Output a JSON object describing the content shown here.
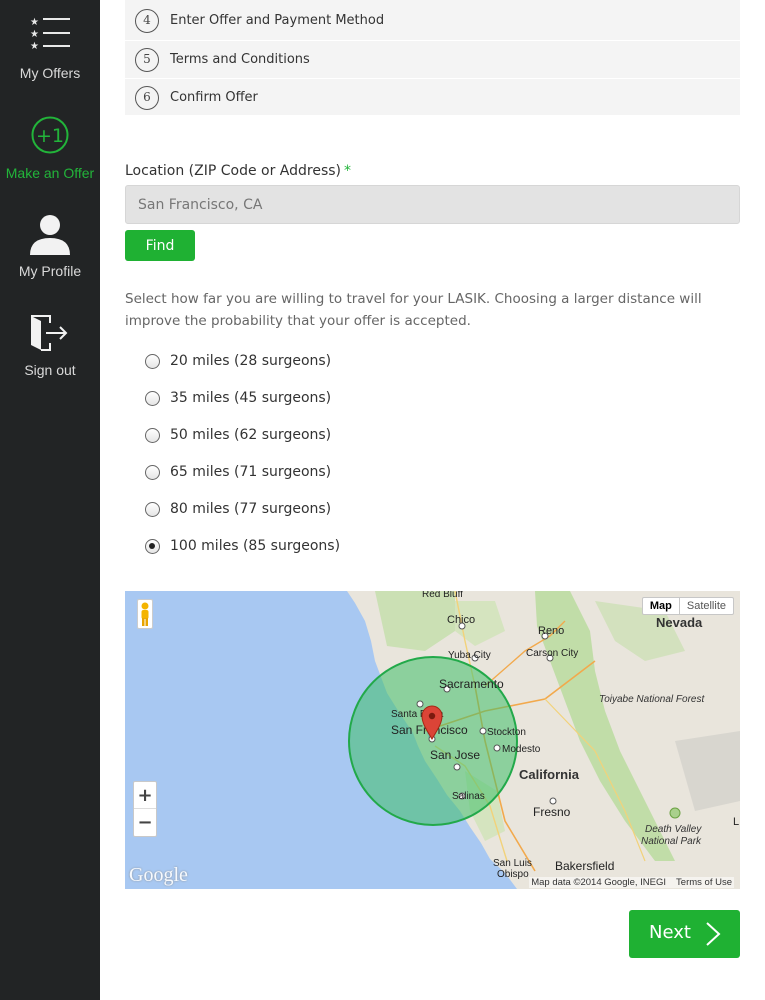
{
  "sidebar": {
    "items": [
      {
        "label": "My Offers",
        "icon": "offers-list-icon"
      },
      {
        "label": "Make an Offer",
        "icon": "plus-one-circle-icon"
      },
      {
        "label": "My Profile",
        "icon": "person-icon"
      },
      {
        "label": "Sign out",
        "icon": "sign-out-door-icon"
      }
    ],
    "active_index": 1,
    "colors": {
      "background": "#222425",
      "active": "#22b43a",
      "text": "#d9d9d9"
    }
  },
  "steps": [
    {
      "number": "4",
      "label": "Enter Offer and Payment Method"
    },
    {
      "number": "5",
      "label": "Terms and Conditions"
    },
    {
      "number": "6",
      "label": "Confirm Offer"
    }
  ],
  "location": {
    "label": "Location (ZIP Code or Address)",
    "required_mark": "*",
    "value": "San Francisco, CA",
    "find_label": "Find"
  },
  "instructions": "Select how far you are willing to travel for your LASIK. Choosing a larger distance will improve the probability that your offer is accepted.",
  "distance_options": [
    {
      "label": "20 miles (28 surgeons)",
      "checked": false
    },
    {
      "label": "35 miles (45 surgeons)",
      "checked": false
    },
    {
      "label": "50 miles (62 surgeons)",
      "checked": false
    },
    {
      "label": "65 miles (71 surgeons)",
      "checked": false
    },
    {
      "label": "80 miles (77 surgeons)",
      "checked": false
    },
    {
      "label": "100 miles (85 surgeons)",
      "checked": true
    }
  ],
  "map": {
    "type_buttons": {
      "map": "Map",
      "satellite": "Satellite"
    },
    "zoom": {
      "in": "+",
      "out": "−"
    },
    "logo": "Google",
    "attribution": "Map data ©2014 Google, INEGI",
    "terms": "Terms of Use",
    "places": {
      "red_bluff": "Red Bluff",
      "chico": "Chico",
      "reno": "Reno",
      "nevada": "Nevada",
      "yuba_city": "Yuba City",
      "carson_city": "Carson City",
      "sacramento": "Sacramento",
      "toiyabe": "Toiyabe National Forest",
      "santa_rosa": "Santa Rosa",
      "san_francisco": "San Francisco",
      "stockton": "Stockton",
      "modesto": "Modesto",
      "san_jose": "San Jose",
      "california": "California",
      "salinas": "Salinas",
      "fresno": "Fresno",
      "death_valley_1": "Death Valley",
      "death_valley_2": "National Park",
      "san_luis_1": "San Luis",
      "san_luis_2": "Obispo",
      "bakersfield": "Bakersfield",
      "cut_letter": "L"
    },
    "colors": {
      "water": "#a8c8f2",
      "land": "#e9e5dc",
      "radius_fill": "#3fbf6a",
      "marker": "#db4437"
    }
  },
  "next_label": "Next",
  "accent_color": "#1fb133"
}
